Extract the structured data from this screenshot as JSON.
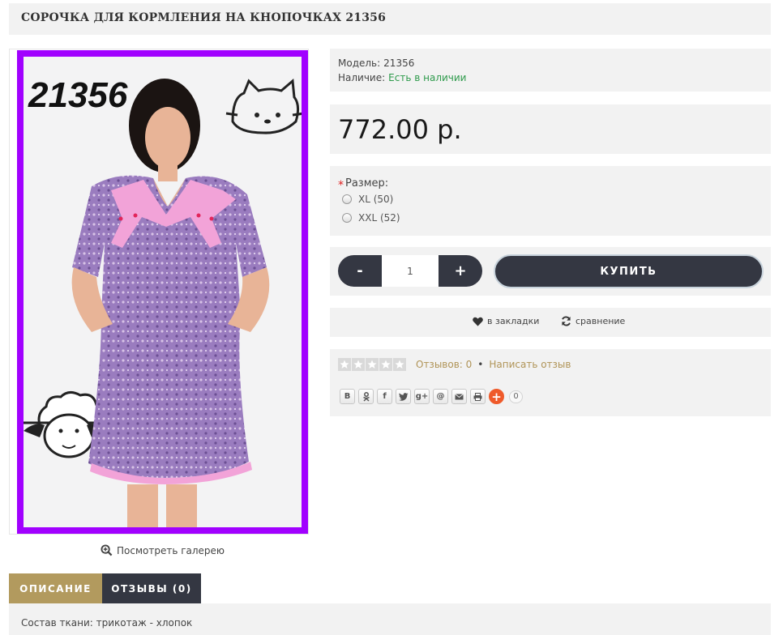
{
  "product": {
    "title": "СОРОЧКА ДЛЯ КОРМЛЕНИЯ НА КНОПОЧКАХ 21356",
    "image_badge": "21356"
  },
  "gallery": {
    "link_label": "Посмотреть галерею"
  },
  "info": {
    "model_label": "Модель:",
    "model_value": "21356",
    "availability_label": "Наличие:",
    "availability_value": "Есть в наличии",
    "availability_color": "#2d9a4b"
  },
  "price": "772.00 р.",
  "options": {
    "required_mark": "*",
    "label": "Размер:",
    "choices": [
      "XL (50)",
      "XXL (52)"
    ]
  },
  "cart": {
    "minus": "-",
    "quantity": "1",
    "plus": "+",
    "buy_label": "КУПИТЬ"
  },
  "actions": {
    "bookmark": "в закладки",
    "compare": "сравнение"
  },
  "reviews": {
    "rating": 0,
    "count_text": "Отзывов: 0",
    "separator": "•",
    "write_text": "Написать отзыв"
  },
  "share": {
    "buttons": [
      "В",
      "ok",
      "f",
      "tw",
      "g+",
      "@",
      "mail",
      "print"
    ],
    "plus": "+",
    "count": "0"
  },
  "tabs": [
    {
      "label": "ОПИСАНИЕ",
      "active": true
    },
    {
      "label": "ОТЗЫВЫ (0)",
      "active": false
    }
  ],
  "description": "Состав ткани: трикотаж - хлопок",
  "colors": {
    "accent_gold": "#b29a5e",
    "dark": "#343742",
    "photo_border": "#a100ff"
  }
}
